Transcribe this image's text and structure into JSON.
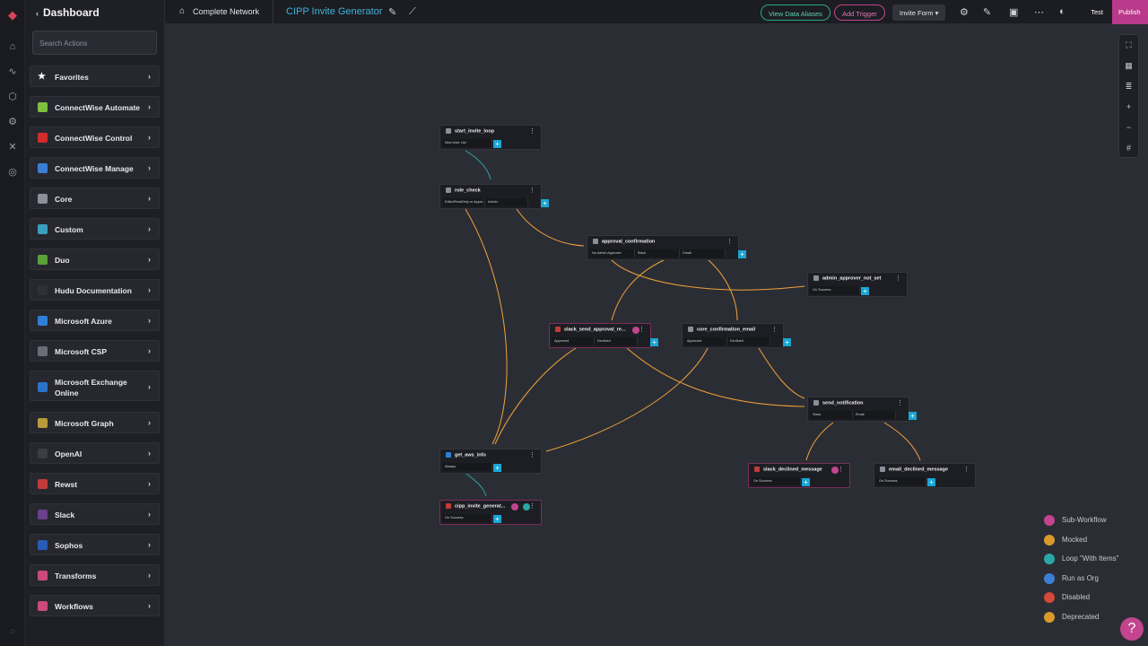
{
  "sidebar": {
    "back_label": "Dashboard",
    "search_placeholder": "Search Actions",
    "categories": [
      {
        "label": "Favorites",
        "icon": "star-icon",
        "color": "#ffffff"
      },
      {
        "label": "ConnectWise Automate",
        "icon": "gear-icon",
        "color": "#7fbf3f"
      },
      {
        "label": "ConnectWise Control",
        "icon": "screen-icon",
        "color": "#d22b2b"
      },
      {
        "label": "ConnectWise Manage",
        "icon": "manage-icon",
        "color": "#3b7fd4"
      },
      {
        "label": "Core",
        "icon": "core-icon",
        "color": "#8a8f9a"
      },
      {
        "label": "Custom",
        "icon": "custom-icon",
        "color": "#3a9fbf"
      },
      {
        "label": "Duo",
        "icon": "duo-icon",
        "color": "#5aa13a"
      },
      {
        "label": "Hudu Documentation",
        "icon": "hudu-icon",
        "color": "#2f3138"
      },
      {
        "label": "Microsoft Azure",
        "icon": "azure-icon",
        "color": "#2f7fd8"
      },
      {
        "label": "Microsoft CSP",
        "icon": "csp-icon",
        "color": "#6a6d78"
      },
      {
        "label": "Microsoft Exchange Online",
        "icon": "exchange-icon",
        "color": "#2b72c9"
      },
      {
        "label": "Microsoft Graph",
        "icon": "graph-icon",
        "color": "#b89a3a"
      },
      {
        "label": "OpenAI",
        "icon": "openai-icon",
        "color": "#3b3d44"
      },
      {
        "label": "Rewst",
        "icon": "rewst-icon",
        "color": "#c23a3a"
      },
      {
        "label": "Slack",
        "icon": "slack-icon",
        "color": "#6a3f8c"
      },
      {
        "label": "Sophos",
        "icon": "sophos-icon",
        "color": "#2a5bb5"
      },
      {
        "label": "Transforms",
        "icon": "transforms-icon",
        "color": "#c94b7a"
      },
      {
        "label": "Workflows",
        "icon": "workflows-icon",
        "color": "#c94b7a"
      }
    ]
  },
  "header": {
    "breadcrumb": "Complete Network",
    "workflow_name": "CIPP Invite Generator",
    "view_aliases": "View Data Aliases",
    "add_trigger": "Add Trigger",
    "form_select": "Invite Form",
    "test": "Test",
    "publish": "Publish"
  },
  "nodes": [
    {
      "name": "start_invite_loop",
      "outputs": [
        "New User List"
      ]
    },
    {
      "name": "role_check",
      "outputs": [
        "EditorReadOnly or Appro...",
        "Admin"
      ]
    },
    {
      "name": "approval_confirmation",
      "outputs": [
        "No Admin Approver",
        "Slack",
        "Email"
      ]
    },
    {
      "name": "admin_approver_not_set",
      "outputs": [
        "On Success"
      ]
    },
    {
      "name": "slack_send_approval_re...",
      "outputs": [
        "Approved",
        "Declined"
      ]
    },
    {
      "name": "core_confirmation_email",
      "outputs": [
        "Approved",
        "Declined"
      ]
    },
    {
      "name": "send_notification",
      "outputs": [
        "Slack",
        "Email"
      ]
    },
    {
      "name": "get_aws_info",
      "outputs": [
        "Always"
      ]
    },
    {
      "name": "slack_declined_message",
      "outputs": [
        "On Success"
      ]
    },
    {
      "name": "email_declined_message",
      "outputs": [
        "On Success"
      ]
    },
    {
      "name": "cipp_invite_generat...",
      "outputs": [
        "On Success"
      ]
    }
  ],
  "legend": [
    {
      "label": "Sub-Workflow",
      "color": "#c2458e"
    },
    {
      "label": "Mocked",
      "color": "#d99a2b"
    },
    {
      "label": "Loop \"With Items\"",
      "color": "#2aa7a7"
    },
    {
      "label": "Run as Org",
      "color": "#3b7fd4"
    },
    {
      "label": "Disabled",
      "color": "#d24a3a"
    },
    {
      "label": "Deprecated",
      "color": "#d99a2b"
    }
  ],
  "colors": {
    "edge_orange": "#f0a33a",
    "edge_teal": "#2aa7a7",
    "accent": "#1aa6d4",
    "brand": "#b93a8a"
  }
}
